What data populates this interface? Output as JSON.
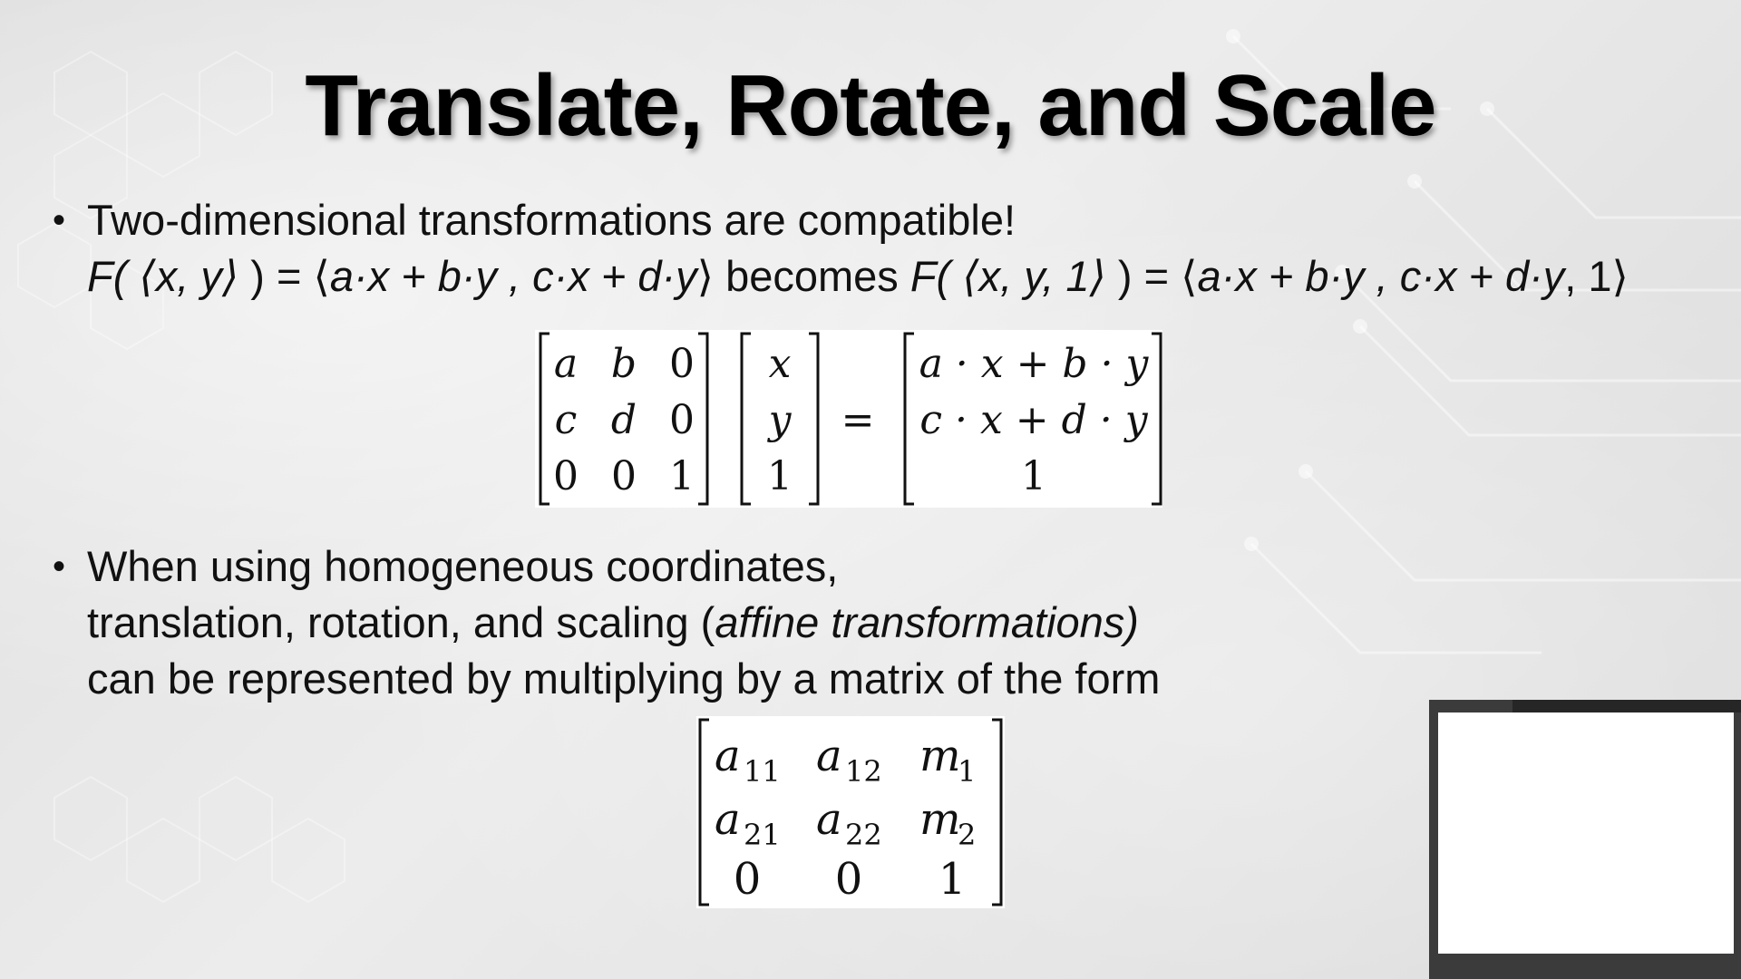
{
  "slide": {
    "title": "Translate, Rotate, and Scale",
    "bullet_glyph": "•",
    "bullet1": {
      "line1": "Two-dimensional transformations are compatible!",
      "line2": {
        "f1": "F(",
        "v1": " ⟨x, y⟩ ",
        "p1": ") = ⟨",
        "e1": "a·x + b·y , c·x + d·y",
        "close1": "⟩",
        "becomes": " becomes ",
        "f2": "F(",
        "v2": " ⟨x, y, 1⟩ ",
        "p2": ") = ⟨",
        "e2": "a·x + b·y , c·x + d·y",
        "close2": ", 1⟩"
      }
    },
    "matrix1": {
      "m": [
        [
          "a",
          "b",
          "0"
        ],
        [
          "c",
          "d",
          "0"
        ],
        [
          "0",
          "0",
          "1"
        ]
      ],
      "v": [
        "x",
        "y",
        "1"
      ],
      "eq": "=",
      "r": [
        "a · x + b · y",
        "c · x + d · y",
        "1"
      ]
    },
    "bullet2": {
      "line1": "When using homogeneous coordinates,",
      "line2_a": "translation, rotation, and scaling (",
      "line2_b": "affine transformations)",
      "line3": "can be represented by multiplying by a matrix of the form"
    },
    "matrix2": {
      "rows": [
        [
          {
            "b": "a",
            "s": "11"
          },
          {
            "b": "a",
            "s": "12"
          },
          {
            "b": "m",
            "s": "1"
          }
        ],
        [
          {
            "b": "a",
            "s": "21"
          },
          {
            "b": "a",
            "s": "22"
          },
          {
            "b": "m",
            "s": "2"
          }
        ],
        [
          {
            "b": "0",
            "s": ""
          },
          {
            "b": "0",
            "s": ""
          },
          {
            "b": "1",
            "s": ""
          }
        ]
      ]
    }
  }
}
